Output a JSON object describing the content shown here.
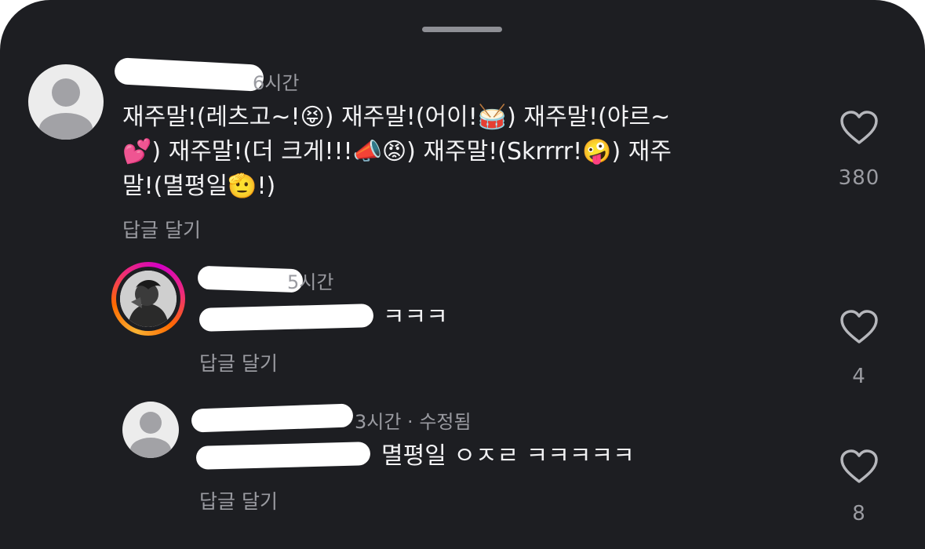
{
  "comments": [
    {
      "time": "6시간",
      "lines": [
        "재주말!(레츠고~!😝) 재주말!(어이!🥁) 재주말!(야르~",
        "💕) 재주말!(더 크게!!!📣😡) 재주말!(Skrrrr!🤪) 재주",
        "말!(멸평일🫡!)"
      ],
      "reply_label": "답글 달기",
      "likes": "380"
    },
    {
      "time": "5시간",
      "text": "ㅋㅋㅋ",
      "reply_label": "답글 달기",
      "likes": "4"
    },
    {
      "time": "3시간 · 수정됨",
      "text": "멸평일 ㅇㅈㄹ ㅋㅋㅋㅋㅋ",
      "reply_label": "답글 달기",
      "likes": "8"
    }
  ],
  "icons": [
    "heart-icon",
    "default-avatar-icon"
  ],
  "colors": {
    "background": "#1d1e22",
    "text": "#f2f2f4",
    "muted": "#9a9ba1",
    "mention": "#7f9ed6"
  }
}
